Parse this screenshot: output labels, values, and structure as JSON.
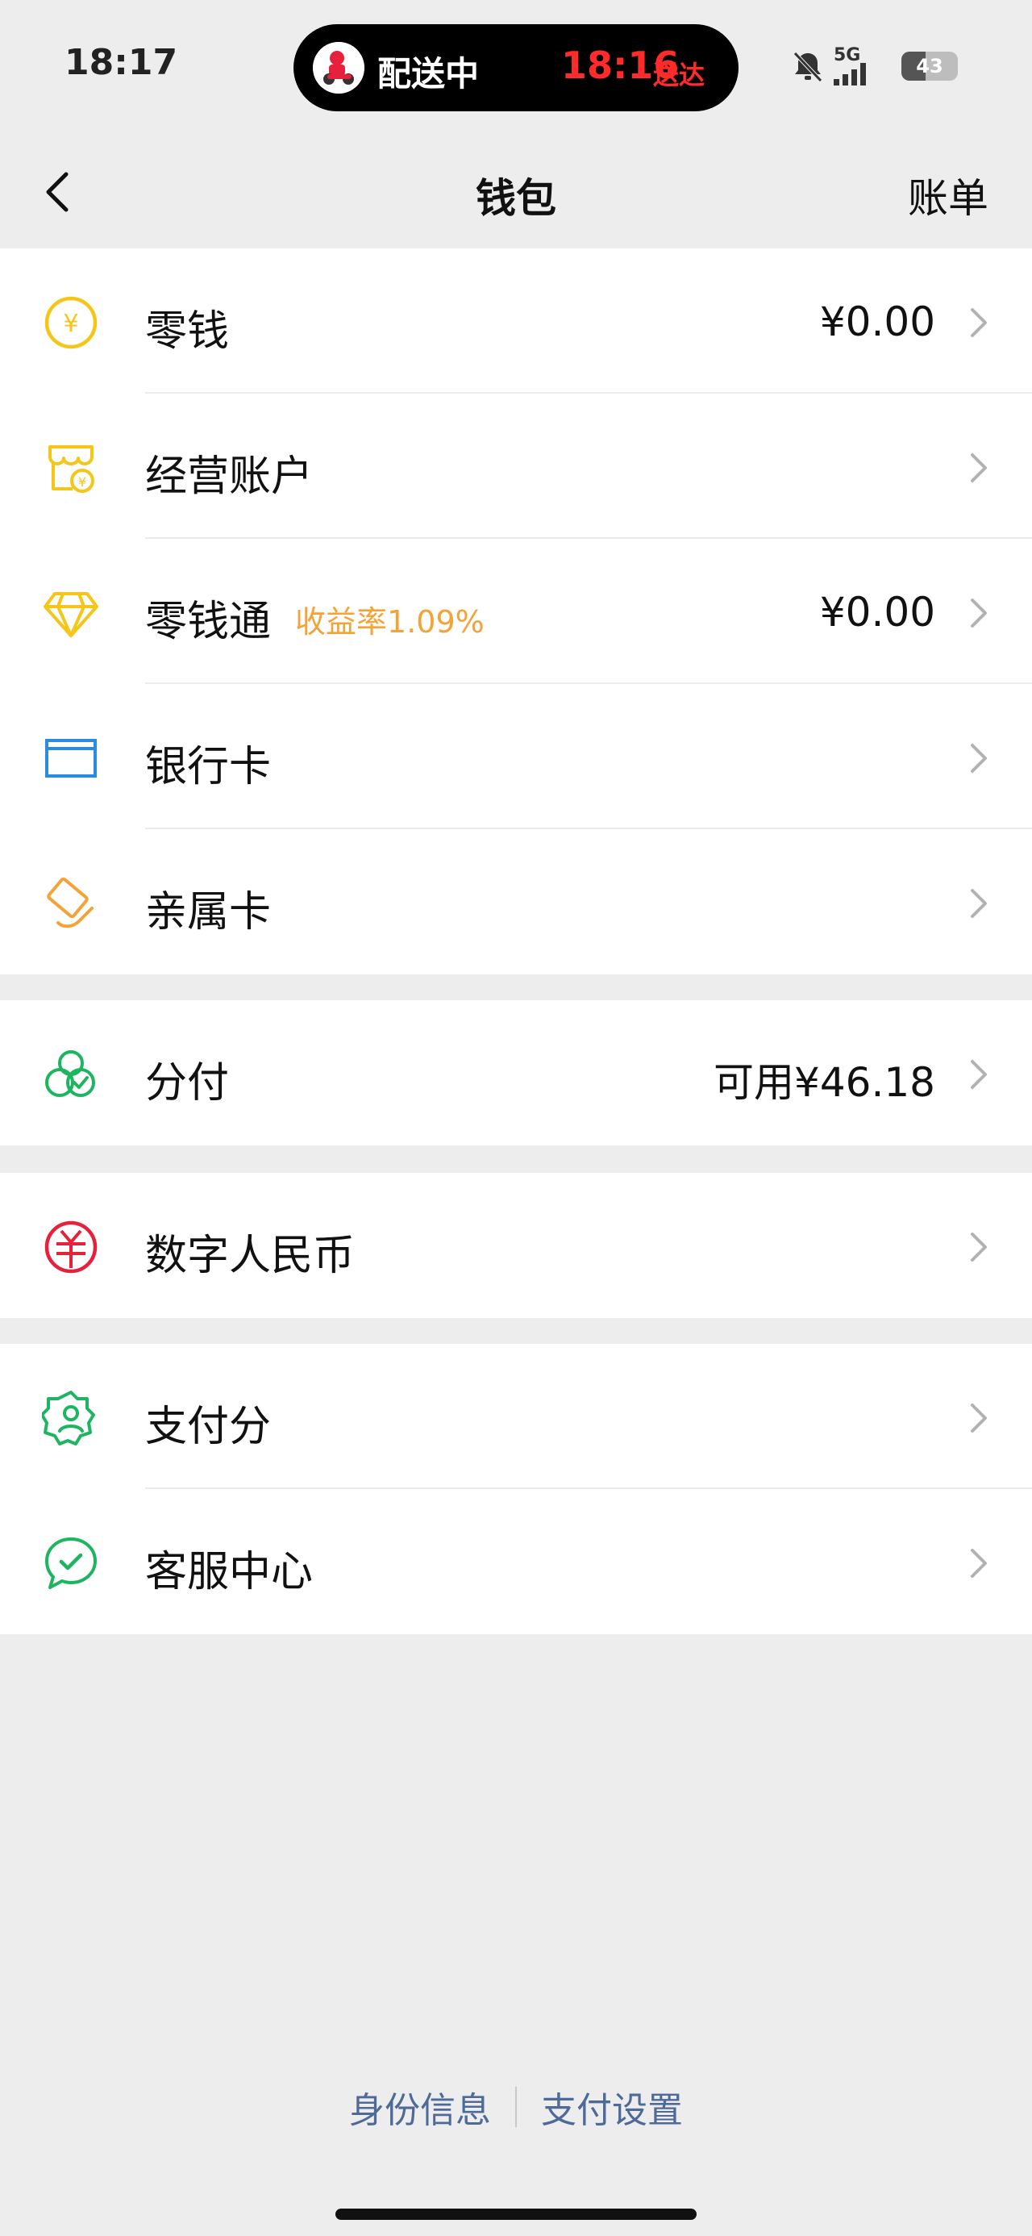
{
  "status_bar": {
    "time": "18:17",
    "island_label": "配送中",
    "island_eta": "18:16",
    "island_eta_suffix": "送达",
    "network": "5G",
    "battery": "43",
    "icons": [
      "bell-muted-icon",
      "signal-icon",
      "battery-icon"
    ]
  },
  "nav": {
    "title": "钱包",
    "action": "账单",
    "back_icon": "chevron-left-icon"
  },
  "groups": [
    {
      "items": [
        {
          "label": "零钱",
          "value": "¥0.00",
          "icon": "coin-yen-icon",
          "color": "#f5c518"
        },
        {
          "label": "经营账户",
          "value": "",
          "icon": "store-account-icon",
          "color": "#f5c518"
        },
        {
          "label": "零钱通",
          "tag": "收益率1.09%",
          "value": "¥0.00",
          "icon": "diamond-icon",
          "color": "#f5c518"
        },
        {
          "label": "银行卡",
          "value": "",
          "icon": "bank-card-icon",
          "color": "#2a8ce0"
        },
        {
          "label": "亲属卡",
          "value": "",
          "icon": "family-card-icon",
          "color": "#f3a338"
        }
      ]
    },
    {
      "items": [
        {
          "label": "分付",
          "value": "可用¥46.18",
          "icon": "fenfu-icon",
          "color": "#1db55f"
        }
      ]
    },
    {
      "items": [
        {
          "label": "数字人民币",
          "value": "",
          "icon": "digital-rmb-icon",
          "color": "#e5213b"
        }
      ]
    },
    {
      "items": [
        {
          "label": "支付分",
          "value": "",
          "icon": "pay-score-icon",
          "color": "#1db55f"
        },
        {
          "label": "客服中心",
          "value": "",
          "icon": "customer-service-icon",
          "color": "#1db55f"
        }
      ]
    }
  ],
  "footer": {
    "identity": "身份信息",
    "settings": "支付设置"
  },
  "colors": {
    "background": "#ededed",
    "link": "#4d6a98",
    "tag": "#f3a338",
    "eta": "#ff2a2a"
  }
}
